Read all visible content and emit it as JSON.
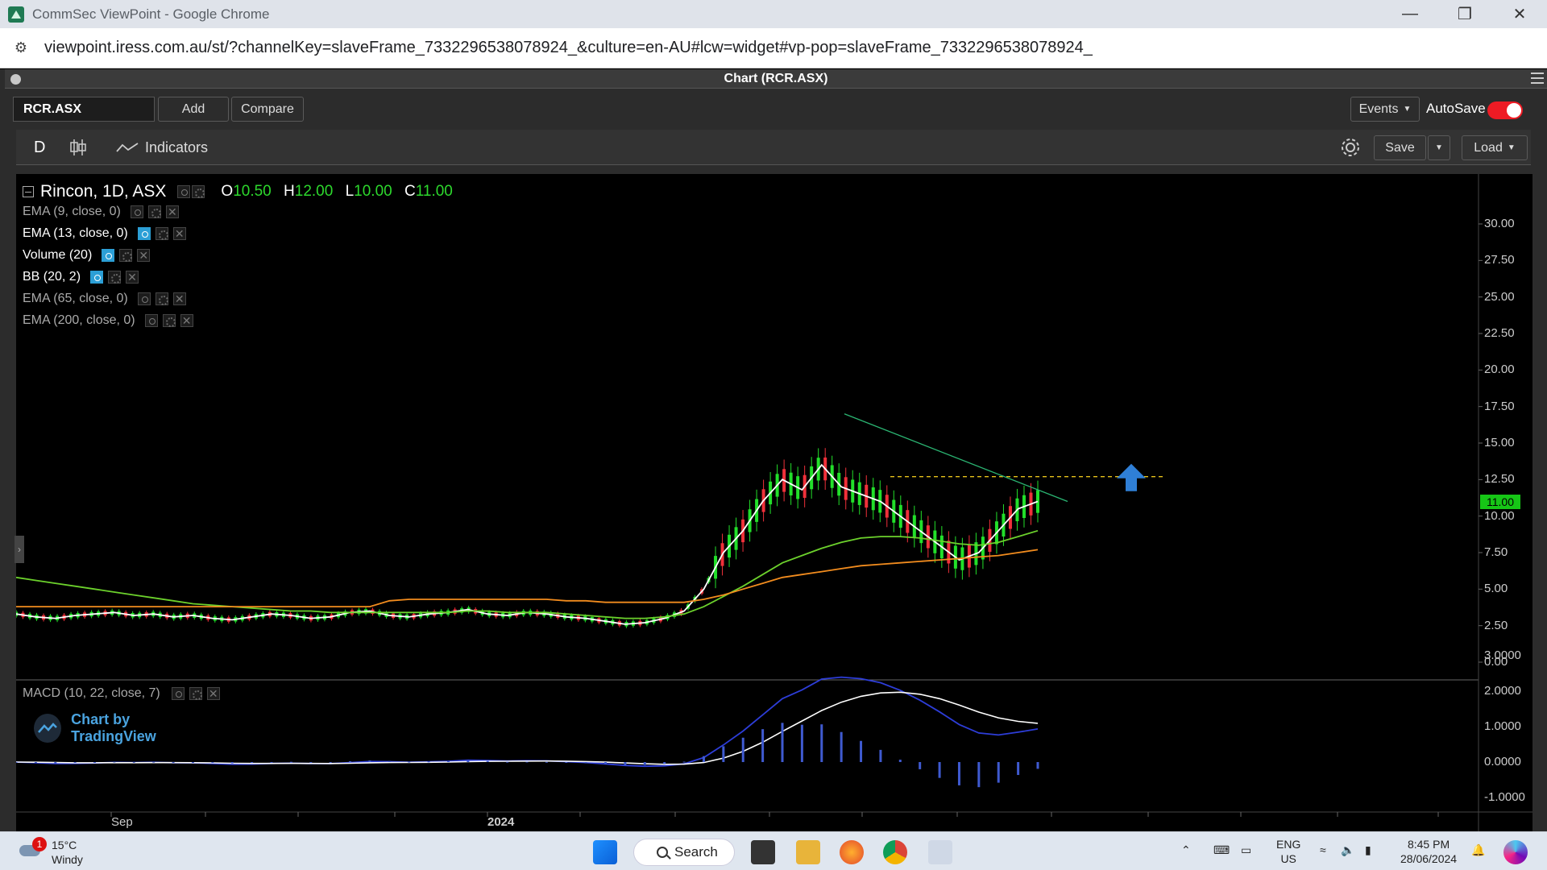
{
  "window": {
    "title": "CommSec ViewPoint - Google Chrome",
    "url": "viewpoint.iress.com.au/st/?channelKey=slaveFrame_7332296538078924_&culture=en-AU#lcw=widget#vp-pop=slaveFrame_7332296538078924_"
  },
  "panel": {
    "title": "Chart (RCR.ASX)"
  },
  "toolbar": {
    "symbol": "RCR.ASX",
    "add_label": "Add",
    "compare_label": "Compare",
    "events_label": "Events",
    "autosave_label": "AutoSave",
    "autosave_on": true
  },
  "chart_toolbar": {
    "interval": "D",
    "indicators_label": "Indicators",
    "save_label": "Save",
    "load_label": "Load"
  },
  "legend": {
    "symbol_line": "Rincon, 1D, ASX",
    "ohlc": {
      "o_label": "O",
      "o": "10.50",
      "h_label": "H",
      "h": "12.00",
      "l_label": "L",
      "l": "10.00",
      "c_label": "C",
      "c": "11.00"
    },
    "indicators": [
      {
        "label": "EMA (9, close, 0)",
        "visible": false
      },
      {
        "label": "EMA (13, close, 0)",
        "visible": true
      },
      {
        "label": "Volume (20)",
        "visible": true
      },
      {
        "label": "BB (20, 2)",
        "visible": true
      },
      {
        "label": "EMA (65, close, 0)",
        "visible": false
      },
      {
        "label": "EMA (200, close, 0)",
        "visible": false
      }
    ],
    "macd_label": "MACD (10, 22, close, 7)"
  },
  "branding": {
    "text": "Chart by TradingView"
  },
  "chart_data": {
    "type": "line",
    "price_axis": [
      "30.00",
      "27.50",
      "25.00",
      "22.50",
      "20.00",
      "17.50",
      "15.00",
      "12.50",
      "10.00",
      "7.50",
      "5.00",
      "2.50",
      "0.00"
    ],
    "macd_axis": [
      "3.0000",
      "2.0000",
      "1.0000",
      "0.0000",
      "-1.0000"
    ],
    "time_axis": [
      "Sep",
      "2024"
    ],
    "last_price": "11.00",
    "ylim": [
      0,
      30
    ],
    "series": [
      {
        "values": [
          3.3,
          3.1,
          3.0,
          3.2,
          3.3,
          3.4,
          3.2,
          3.3,
          3.1,
          3.2,
          3.0,
          2.9,
          3.1,
          3.3,
          3.2,
          3.0,
          3.1,
          3.4,
          3.5,
          3.2,
          3.1,
          3.3,
          3.4,
          3.6,
          3.3,
          3.2,
          3.4,
          3.3,
          3.1,
          3.0,
          2.8,
          2.6,
          2.7,
          3.0,
          3.5,
          5.0,
          7.5,
          9.0,
          11.0,
          12.5,
          11.8,
          13.5,
          12.0,
          11.5,
          11.0,
          10.0,
          9.0,
          8.0,
          7.0,
          7.5,
          9.0,
          10.5,
          11.0
        ],
        "color": "#ffffff"
      },
      {
        "values": [
          5.8,
          5.6,
          5.4,
          5.2,
          5.0,
          4.8,
          4.6,
          4.4,
          4.2,
          4.0,
          3.9,
          3.8,
          3.7,
          3.6,
          3.5,
          3.5,
          3.4,
          3.4,
          3.4,
          3.4,
          3.4,
          3.4,
          3.4,
          3.5,
          3.5,
          3.4,
          3.4,
          3.4,
          3.3,
          3.2,
          3.1,
          3.0,
          3.0,
          3.1,
          3.3,
          3.8,
          4.5,
          5.2,
          6.0,
          6.8,
          7.3,
          7.8,
          8.2,
          8.5,
          8.6,
          8.6,
          8.5,
          8.3,
          8.1,
          8.0,
          8.2,
          8.6,
          9.0
        ],
        "color": "#6cd12c"
      },
      {
        "values": [
          3.8,
          3.8,
          3.8,
          3.8,
          3.8,
          3.8,
          3.8,
          3.8,
          3.8,
          3.8,
          3.8,
          3.8,
          3.8,
          3.8,
          3.8,
          3.8,
          3.8,
          3.8,
          3.8,
          4.2,
          4.3,
          4.3,
          4.3,
          4.3,
          4.3,
          4.3,
          4.3,
          4.3,
          4.2,
          4.2,
          4.1,
          4.1,
          4.1,
          4.1,
          4.1,
          4.3,
          4.6,
          5.0,
          5.4,
          5.8,
          6.0,
          6.2,
          6.4,
          6.6,
          6.7,
          6.8,
          6.9,
          7.0,
          7.1,
          7.2,
          7.3,
          7.5,
          7.7
        ],
        "color": "#f28c1e"
      }
    ],
    "resistance_level": 12.7,
    "trendline": [
      [
        17.0,
        0
      ],
      [
        11.0,
        1
      ]
    ]
  }
}
